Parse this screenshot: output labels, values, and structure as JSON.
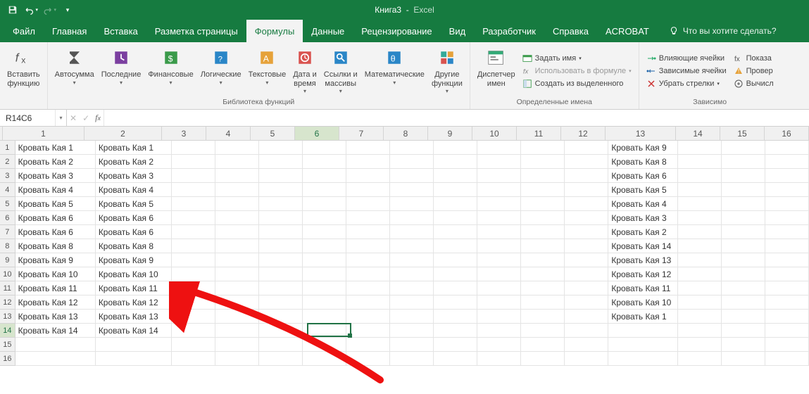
{
  "app": {
    "doc": "Книга3",
    "suffix": "Excel"
  },
  "qat_icons": [
    "save-icon",
    "undo-icon",
    "redo-icon",
    "customize-icon"
  ],
  "tabs": {
    "items": [
      "Файл",
      "Главная",
      "Вставка",
      "Разметка страницы",
      "Формулы",
      "Данные",
      "Рецензирование",
      "Вид",
      "Разработчик",
      "Справка",
      "ACROBAT"
    ],
    "active_index": 4,
    "tell_me": "Что вы хотите сделать?"
  },
  "ribbon": {
    "insert_function": "Вставить\nфункцию",
    "library": {
      "label": "Библиотека функций",
      "items": [
        {
          "k": "autosum",
          "label": "Автосумма",
          "drop": true
        },
        {
          "k": "recent",
          "label": "Последние",
          "drop": true
        },
        {
          "k": "financial",
          "label": "Финансовые",
          "drop": true
        },
        {
          "k": "logical",
          "label": "Логические",
          "drop": true
        },
        {
          "k": "text",
          "label": "Текстовые",
          "drop": true
        },
        {
          "k": "datetime",
          "label": "Дата и\nвремя",
          "drop": true
        },
        {
          "k": "lookup",
          "label": "Ссылки и\nмассивы",
          "drop": true
        },
        {
          "k": "math",
          "label": "Математические",
          "drop": true
        },
        {
          "k": "more",
          "label": "Другие\nфункции",
          "drop": true
        }
      ]
    },
    "names": {
      "manager": "Диспетчер\nимен",
      "label": "Определенные имена",
      "items": [
        {
          "k": "define",
          "label": "Задать имя",
          "drop": true,
          "dim": false
        },
        {
          "k": "usein",
          "label": "Использовать в формуле",
          "drop": true,
          "dim": true
        },
        {
          "k": "create",
          "label": "Создать из выделенного",
          "drop": false,
          "dim": false
        }
      ]
    },
    "audit": {
      "label": "Зависимо",
      "left": [
        {
          "k": "prec",
          "label": "Влияющие ячейки"
        },
        {
          "k": "dep",
          "label": "Зависимые ячейки"
        },
        {
          "k": "rem",
          "label": "Убрать стрелки",
          "drop": true
        }
      ],
      "right": [
        {
          "k": "show",
          "label": "Показа"
        },
        {
          "k": "err",
          "label": "Провер"
        },
        {
          "k": "eval",
          "label": "Вычисл"
        }
      ]
    }
  },
  "formula_bar": {
    "name_box": "R14C6"
  },
  "sheet": {
    "columns": [
      1,
      2,
      3,
      4,
      5,
      6,
      7,
      8,
      9,
      10,
      11,
      12,
      13,
      14,
      15,
      16
    ],
    "rows": [
      1,
      2,
      3,
      4,
      5,
      6,
      7,
      8,
      9,
      10,
      11,
      12,
      13,
      14,
      15,
      16
    ],
    "selected": {
      "row": 14,
      "col": 6
    },
    "data": {
      "c1": [
        "Кровать Кая 1",
        "Кровать Кая 2",
        "Кровать Кая 3",
        "Кровать Кая 4",
        "Кровать Кая 5",
        "Кровать Кая 6",
        "Кровать Кая 6",
        "Кровать Кая 8",
        "Кровать Кая 9",
        "Кровать Кая 10",
        "Кровать Кая 11",
        "Кровать Кая 12",
        "Кровать Кая 13",
        "Кровать Кая 14"
      ],
      "c2": [
        "Кровать Кая 1",
        "Кровать Кая 2",
        "Кровать Кая 3",
        "Кровать Кая 4",
        "Кровать Кая 5",
        "Кровать Кая 6",
        "Кровать Кая 6",
        "Кровать Кая 8",
        "Кровать Кая 9",
        "Кровать Кая 10",
        "Кровать Кая 11",
        "Кровать Кая 12",
        "Кровать Кая 13",
        "Кровать Кая 14"
      ],
      "c13": [
        "Кровать Кая 9",
        "Кровать Кая 8",
        "Кровать Кая 6",
        "Кровать Кая 5",
        "Кровать Кая 4",
        "Кровать Кая 3",
        "Кровать Кая 2",
        "Кровать Кая 14",
        "Кровать Кая 13",
        "Кровать Кая 12",
        "Кровать Кая 11",
        "Кровать Кая 10",
        "Кровать Кая 1"
      ]
    }
  }
}
